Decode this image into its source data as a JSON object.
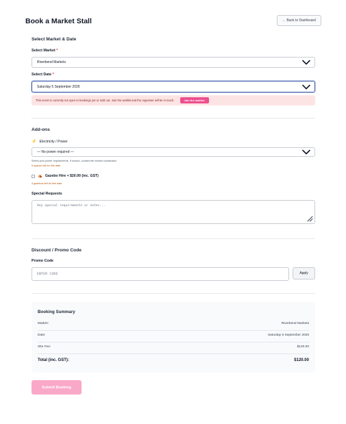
{
  "header": {
    "title": "Book a Market Stall",
    "back_label": "← Back to Dashboard"
  },
  "market_date": {
    "section_title": "Select Market & Date",
    "market_label": "Select Market",
    "market_value": "Riverbend Markets",
    "date_label": "Select Date",
    "date_value": "Saturday 5 September 2026",
    "required_mark": "*",
    "alert_text": "This event is currently not open to bookings yet or sold out. Join the waitlist and the organiser will be in touch.",
    "waitlist_label": "Join the waitlist"
  },
  "addons": {
    "section_title": "Add-ons",
    "power_label": "Electricity / Power",
    "power_value": "— No power required —",
    "power_help": "Select your power requirements. If unsure, contact the market coordinator.",
    "power_remaining": "5 spaces left for this date",
    "gazebo_label": "Gazebo Hire + $20.00 (inc. GST)",
    "gazebo_remaining": "4 gazebos left for this date",
    "special_label": "Special Requests",
    "special_placeholder": "Any special requirements or notes..."
  },
  "promo": {
    "section_title": "Discount / Promo Code",
    "code_label": "Promo Code",
    "code_placeholder": "ENTER CODE",
    "apply_label": "Apply"
  },
  "summary": {
    "title": "Booking Summary",
    "market_key": "Market:",
    "market_val": "Riverbend Markets",
    "date_key": "Date:",
    "date_val": "Saturday 5 September 2026",
    "fee_key": "Site Fee:",
    "fee_val": "$120.00",
    "total_key": "Total (inc. GST):",
    "total_val": "$120.00"
  },
  "footer": {
    "submit_label": "Submit Booking"
  },
  "colors": {
    "accent_pink": "#ec4f8f",
    "alert_bg": "#fde4e4",
    "focus_border": "#3b5ba9"
  }
}
